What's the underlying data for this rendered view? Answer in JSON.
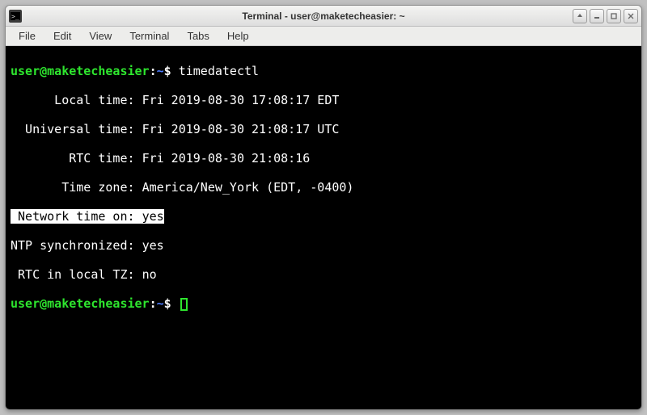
{
  "window": {
    "title": "Terminal - user@maketecheasier: ~"
  },
  "menubar": {
    "items": [
      "File",
      "Edit",
      "View",
      "Terminal",
      "Tabs",
      "Help"
    ]
  },
  "prompt": {
    "user_host": "user@maketecheasier",
    "path": "~",
    "symbol": "$"
  },
  "terminal": {
    "command": "timedatectl",
    "output": {
      "local_time_label": "      Local time:",
      "local_time_value": "Fri 2019-08-30 17:08:17 EDT",
      "universal_time_label": "  Universal time:",
      "universal_time_value": "Fri 2019-08-30 21:08:17 UTC",
      "rtc_time_label": "        RTC time:",
      "rtc_time_value": "Fri 2019-08-30 21:08:16",
      "time_zone_label": "       Time zone:",
      "time_zone_value": "America/New_York (EDT, -0400)",
      "network_time_label": " Network time on:",
      "network_time_value": "yes",
      "ntp_sync_label": "NTP synchronized:",
      "ntp_sync_value": "yes",
      "rtc_local_label": " RTC in local TZ:",
      "rtc_local_value": "no"
    }
  }
}
